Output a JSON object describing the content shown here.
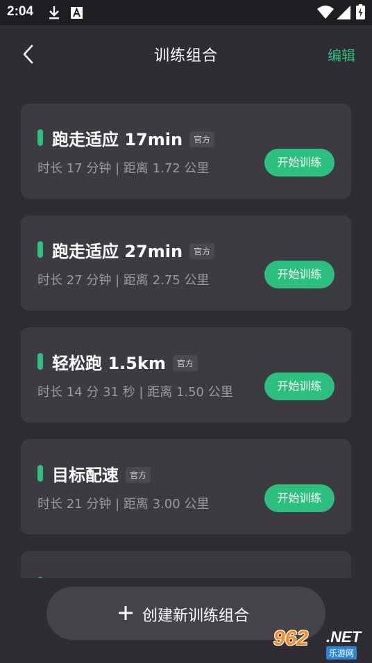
{
  "status_bar": {
    "time": "2:04"
  },
  "header": {
    "title": "训练组合",
    "edit_label": "编辑"
  },
  "workouts": [
    {
      "name": "跑走适应 17min",
      "badge": "官方",
      "meta": "时长 17 分钟 | 距离 1.72 公里",
      "start_label": "开始训练"
    },
    {
      "name": "跑走适应 27min",
      "badge": "官方",
      "meta": "时长 27 分钟 | 距离 2.75 公里",
      "start_label": "开始训练"
    },
    {
      "name": "轻松跑 1.5km",
      "badge": "官方",
      "meta": "时长 14 分 31 秒 | 距离 1.50 公里",
      "start_label": "开始训练"
    },
    {
      "name": "目标配速",
      "badge": "官方",
      "meta": "时长 21 分钟 | 距离 3.00 公里",
      "start_label": "开始训练"
    }
  ],
  "create_button": {
    "label": "创建新训练组合"
  },
  "watermark": {
    "digits": "962",
    "net": ".NET",
    "sub": "乐游网"
  },
  "colors": {
    "accent": "#2cc07e",
    "background": "#2f2c33",
    "card": "#3d3a42",
    "watermark": "#ff8a1a"
  }
}
